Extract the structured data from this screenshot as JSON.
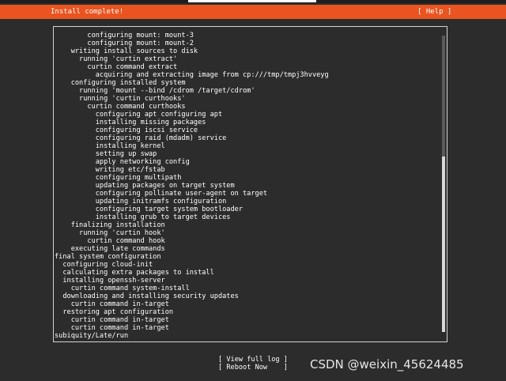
{
  "header": {
    "title": "Install complete!",
    "help_label": "[ Help ]"
  },
  "colors": {
    "accent": "#e95420",
    "background": "#2c2c2c",
    "text": "#ffffff"
  },
  "log": {
    "lines": [
      "        configuring mount: mount-3",
      "        configuring mount: mount-2",
      "    writing install sources to disk",
      "      running 'curtin extract'",
      "        curtin command extract",
      "          acquiring and extracting image from cp:///tmp/tmpj3hvveyg",
      "    configuring installed system",
      "      running 'mount --bind /cdrom /target/cdrom'",
      "      running 'curtin curthooks'",
      "        curtin command curthooks",
      "          configuring apt configuring apt",
      "          installing missing packages",
      "          configuring iscsi service",
      "          configuring raid (mdadm) service",
      "          installing kernel",
      "          setting up swap",
      "          apply networking config",
      "          writing etc/fstab",
      "          configuring multipath",
      "          updating packages on target system",
      "          configuring pollinate user-agent on target",
      "          updating initramfs configuration",
      "          configuring target system bootloader",
      "          installing grub to target devices",
      "    finalizing installation",
      "      running 'curtin hook'",
      "        curtin command hook",
      "    executing late commands",
      "final system configuration",
      "  configuring cloud-init",
      "  calculating extra packages to install",
      "  installing openssh-server",
      "    curtin command system-install",
      "  downloading and installing security updates",
      "    curtin command in-target",
      "  restoring apt configuration",
      "    curtin command in-target",
      "    curtin command in-target",
      "subiquity/Late/run"
    ]
  },
  "actions": {
    "view_full_log": "[ View full log ]",
    "reboot_now": "[ Reboot Now    ]"
  },
  "watermark": "CSDN @weixin_45624485"
}
